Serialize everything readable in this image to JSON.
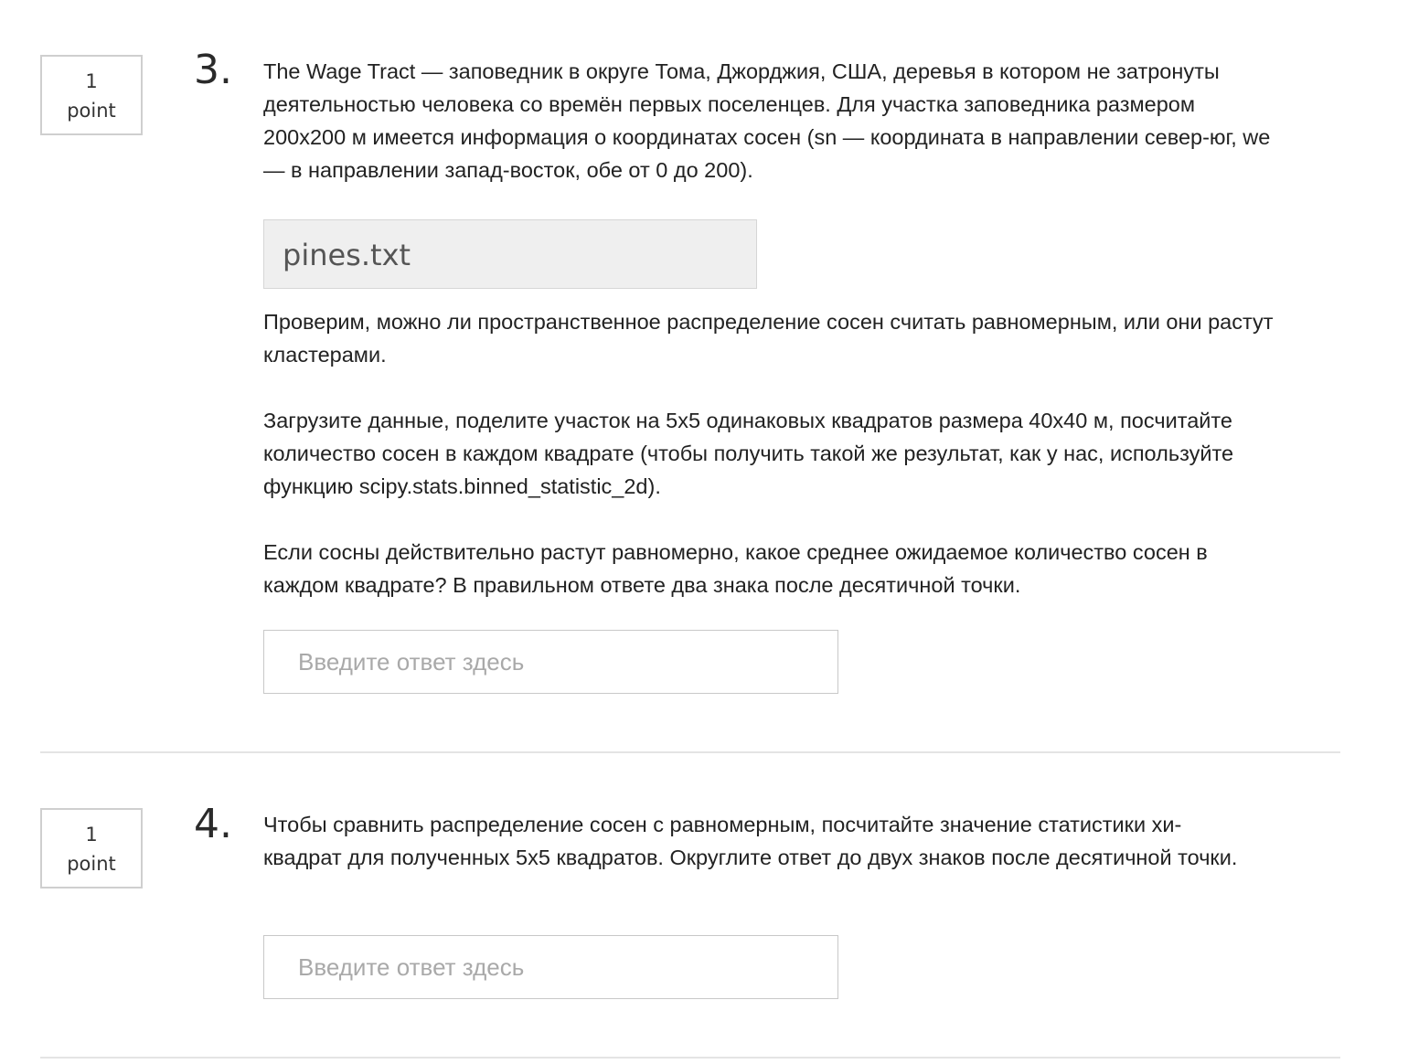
{
  "questions": [
    {
      "points": "1",
      "points_unit": "point",
      "number": "3.",
      "intro": "The Wage Tract — заповедник в округе Тома, Джорджия, США, деревья в котором не затронуты деятельностью человека со времён первых поселенцев. Для участка заповедника размером 200x200 м имеется информация о координатах сосен (sn — координата в направлении север-юг, we — в направлении запад-восток, обе от 0 до 200).",
      "file_name": "pines.txt",
      "paragraph_1": "Проверим, можно ли пространственное распределение сосен считать равномерным, или они растут кластерами.",
      "paragraph_2": "Загрузите данные, поделите участок на 5x5 одинаковых квадратов размера 40x40 м, посчитайте количество сосен в каждом квадрате (чтобы получить такой же результат, как у нас, используйте функцию scipy.stats.binned_statistic_2d).",
      "paragraph_3": "Если сосны действительно растут равномерно, какое среднее ожидаемое количество сосен в каждом квадрате? В правильном ответе два знака после десятичной точки.",
      "answer_placeholder": "Введите ответ здесь",
      "answer_value": ""
    },
    {
      "points": "1",
      "points_unit": "point",
      "number": "4.",
      "intro": "Чтобы сравнить распределение сосен с равномерным, посчитайте значение статистики хи-квадрат для полученных 5x5 квадратов. Округлите ответ до двух знаков после десятичной точки.",
      "answer_placeholder": "Введите ответ здесь",
      "answer_value": ""
    }
  ]
}
